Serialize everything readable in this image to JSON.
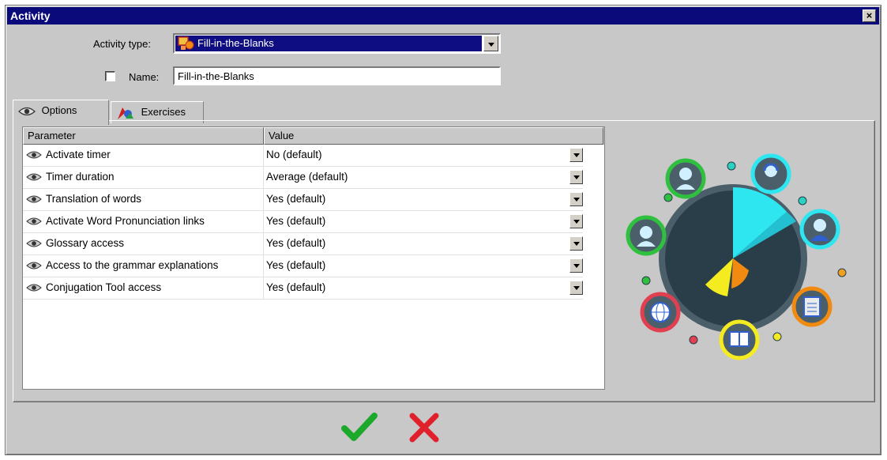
{
  "window": {
    "title": "Activity",
    "close_glyph": "×"
  },
  "form": {
    "activity_type_label": "Activity type:",
    "activity_type_value": "Fill-in-the-Blanks",
    "activity_type_icon": "activity-type-icon",
    "name_label": "Name:",
    "name_checked": false,
    "name_value": "Fill-in-the-Blanks"
  },
  "tabs": [
    {
      "label": "Options",
      "icon": "eye-icon",
      "active": true
    },
    {
      "label": "Exercises",
      "icon": "exercises-icon",
      "active": false
    }
  ],
  "grid": {
    "columns": [
      "Parameter",
      "Value"
    ],
    "rows": [
      {
        "parameter": "Activate timer",
        "value": "No (default)"
      },
      {
        "parameter": "Timer duration",
        "value": "Average (default)"
      },
      {
        "parameter": "Translation of words",
        "value": "Yes (default)"
      },
      {
        "parameter": "Activate Word Pronunciation links",
        "value": "Yes (default)"
      },
      {
        "parameter": "Glossary access",
        "value": "Yes (default)"
      },
      {
        "parameter": "Access to the grammar explanations",
        "value": "Yes (default)"
      },
      {
        "parameter": "Conjugation Tool access",
        "value": "Yes (default)"
      }
    ]
  },
  "footer": {
    "ok_icon": "checkmark-icon",
    "cancel_icon": "cross-icon"
  },
  "colors": {
    "titlebar": "#0a0a7a",
    "selection": "#0e0e82",
    "ok_green": "#1ca82a",
    "cancel_red": "#e0202a",
    "pie_cyan": "#2ee6f0",
    "pie_yellow": "#f4ec20",
    "pie_orange": "#f08a10",
    "pie_dark": "#2a3e4a"
  }
}
